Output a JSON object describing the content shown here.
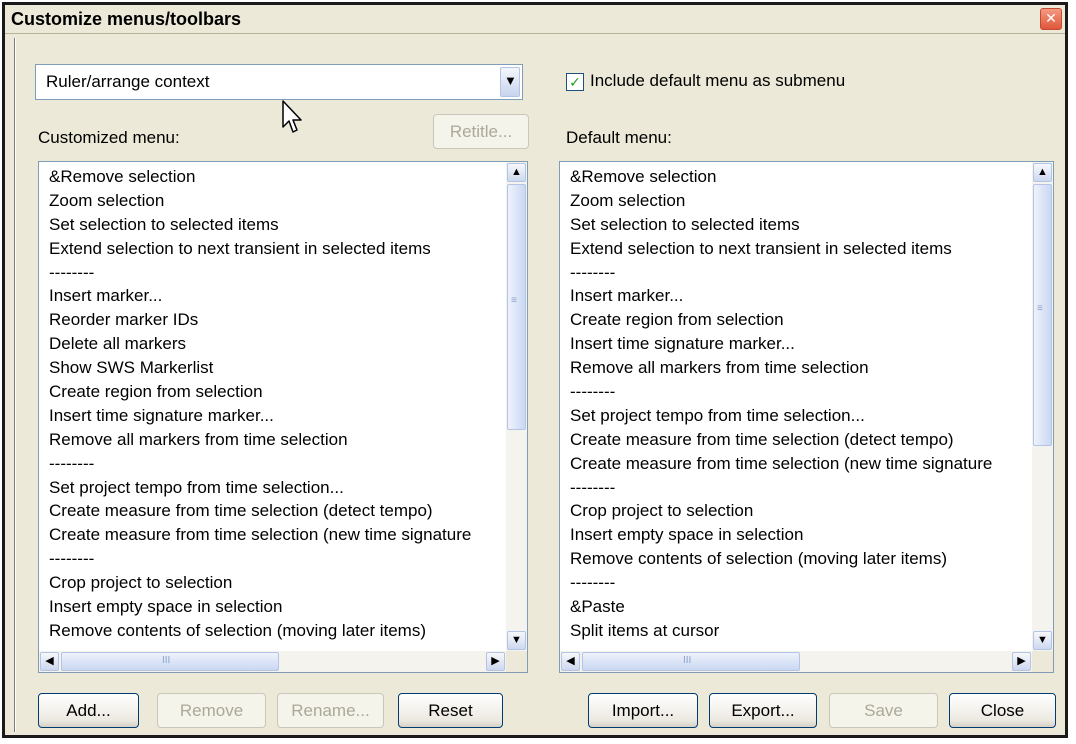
{
  "window": {
    "title": "Customize menus/toolbars",
    "close_glyph": "✕"
  },
  "context_select": {
    "value": "Ruler/arrange context",
    "arrow": "▼"
  },
  "include_default": {
    "label": "Include default menu as submenu",
    "checked": true,
    "mark": "✓"
  },
  "customized": {
    "label": "Customized menu:",
    "retitle_button": "Retitle...",
    "items": [
      "&Remove selection",
      "Zoom selection",
      "Set selection to selected items",
      "Extend selection to next transient in selected items",
      "--------",
      "Insert marker...",
      "Reorder marker IDs",
      "Delete all markers",
      "Show SWS Markerlist",
      "Create region from selection",
      "Insert time signature marker...",
      "Remove all markers from time selection",
      "--------",
      "Set project tempo from time selection...",
      "Create measure from time selection (detect tempo)",
      "Create measure from time selection (new time signature",
      "--------",
      "Crop project to selection",
      "Insert empty space in selection",
      "Remove contents of selection (moving later items)"
    ]
  },
  "default_menu": {
    "label": "Default menu:",
    "items": [
      "&Remove selection",
      "Zoom selection",
      "Set selection to selected items",
      "Extend selection to next transient in selected items",
      "--------",
      "Insert marker...",
      "Create region from selection",
      "Insert time signature marker...",
      "Remove all markers from time selection",
      "--------",
      "Set project tempo from time selection...",
      "Create measure from time selection (detect tempo)",
      "Create measure from time selection (new time signature",
      "--------",
      "Crop project to selection",
      "Insert empty space in selection",
      "Remove contents of selection (moving later items)",
      "--------",
      "&Paste",
      "Split items at cursor"
    ]
  },
  "scroll_glyphs": {
    "up": "▲",
    "down": "▼",
    "left": "◀",
    "right": "▶",
    "grip_v": "≡",
    "grip_h": "III"
  },
  "buttons": {
    "add": "Add...",
    "remove": "Remove",
    "rename": "Rename...",
    "reset": "Reset",
    "import": "Import...",
    "export": "Export...",
    "save": "Save",
    "close": "Close"
  },
  "colors": {
    "dialog_bg": "#ece9d8",
    "border_blue": "#7f9db9",
    "close_red": "#e0563a",
    "check_green": "#21a121"
  }
}
